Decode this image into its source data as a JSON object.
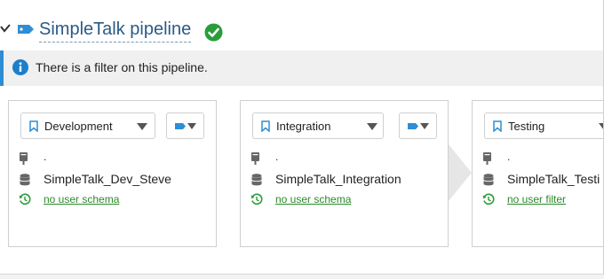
{
  "header": {
    "title": "SimpleTalk pipeline"
  },
  "info_bar": {
    "message": "There is a filter on this pipeline."
  },
  "colors": {
    "title": "#2b5a86",
    "accent_blue": "#2f8dd3",
    "success_green": "#2a9d3a",
    "link_green": "#2a8a2a"
  },
  "icons": {
    "collapse": "chevron-down-icon",
    "tag": "tag-icon",
    "status": "check-circle-icon",
    "info": "info-icon",
    "bookmark": "bookmark-icon",
    "server": "server-icon",
    "database": "database-icon",
    "history": "history-icon"
  },
  "stages": [
    {
      "environment": "Development",
      "server": ".",
      "database": "SimpleTalk_Dev_Steve",
      "link": "no user schema"
    },
    {
      "environment": "Integration",
      "server": ".",
      "database": "SimpleTalk_Integration",
      "link": "no user schema"
    },
    {
      "environment": "Testing",
      "server": ".",
      "database": "SimpleTalk_Testi",
      "link": "no user filter"
    }
  ]
}
